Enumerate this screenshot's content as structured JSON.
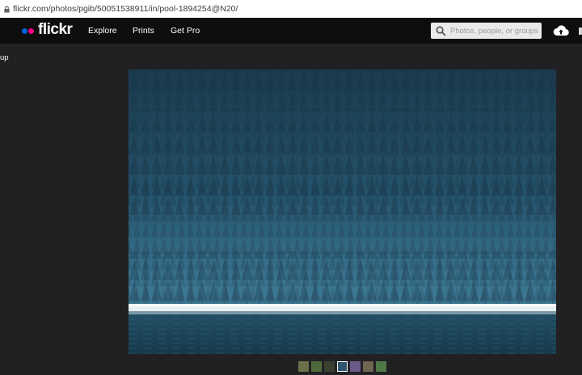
{
  "browser": {
    "url": "flickr.com/photos/pgib/50051538911/in/pool-1894254@N20/"
  },
  "nav": {
    "logo_text": "flickr",
    "links": [
      "Explore",
      "Prints",
      "Get Pro"
    ],
    "search_placeholder": "Photos, people, or groups"
  },
  "page": {
    "back_link_fragment": "up"
  },
  "filmstrip": {
    "thumbnail_count": 7,
    "active_index": 3,
    "thumbnail_colors": [
      "#6b7048",
      "#4e6a3a",
      "#3a4030",
      "#2d566e",
      "#6a5a88",
      "#6e6650",
      "#4f7a48"
    ]
  },
  "colors": {
    "nav_background": "#0e0e0f",
    "page_background": "#212124",
    "brand_blue": "#0063dc",
    "brand_pink": "#ff0084"
  }
}
